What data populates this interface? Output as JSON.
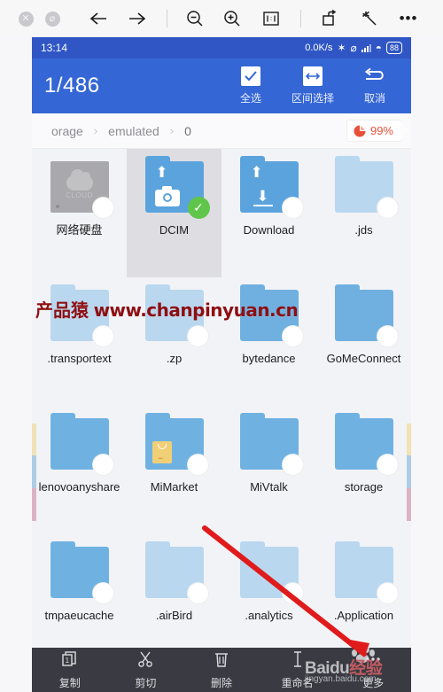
{
  "viewer": {
    "toolbar": [
      {
        "name": "close-button",
        "glyph": "✕",
        "type": "circle"
      },
      {
        "name": "block-button",
        "glyph": "⊘",
        "type": "circle"
      },
      {
        "name": "back-button",
        "glyph": "←",
        "type": "glyph"
      },
      {
        "name": "forward-button",
        "glyph": "→",
        "type": "glyph"
      },
      {
        "name": "separator",
        "glyph": "",
        "type": "sep"
      },
      {
        "name": "zoom-out-icon",
        "glyph": "",
        "type": "zoomout"
      },
      {
        "name": "zoom-in-icon",
        "glyph": "",
        "type": "zoomin"
      },
      {
        "name": "actual-size-icon",
        "glyph": "1:1",
        "type": "box"
      },
      {
        "name": "separator",
        "glyph": "",
        "type": "sep"
      },
      {
        "name": "rotate-icon",
        "glyph": "",
        "type": "rotate"
      },
      {
        "name": "magic-wand-icon",
        "glyph": "",
        "type": "wand"
      },
      {
        "name": "more-options-icon",
        "glyph": "•••",
        "type": "glyph"
      }
    ]
  },
  "status_bar": {
    "time": "13:14",
    "network_speed": "0.0K/s",
    "bluetooth_icon": "✶",
    "mute_icon": "⌀",
    "signal_icon": "signal-bars",
    "wifi_icon": "◠",
    "battery_level": "88"
  },
  "header": {
    "selection_count": "1/486",
    "actions": [
      {
        "label": "全选",
        "icon": "checkbox-checked",
        "name": "select-all"
      },
      {
        "label": "区间选择",
        "icon": "range-arrows",
        "name": "range-select"
      },
      {
        "label": "取消",
        "icon": "undo-arrow",
        "name": "cancel"
      }
    ]
  },
  "breadcrumb": {
    "items": [
      "orage",
      "emulated",
      "0"
    ],
    "separator": "›",
    "storage_badge": {
      "percent": "99%",
      "icon": "pie-chart-icon",
      "color": "#e8503a"
    }
  },
  "files": [
    {
      "name": "网络硬盘",
      "icon": "cloud-drive",
      "selected": false,
      "color": "#a9a9ad",
      "badge": "radio"
    },
    {
      "name": "DCIM",
      "icon": "folder-camera",
      "selected": true,
      "color": "#5ba3dd",
      "badge": "check"
    },
    {
      "name": "Download",
      "icon": "folder-download",
      "selected": false,
      "color": "#5ba3dd",
      "badge": "radio"
    },
    {
      "name": ".jds",
      "icon": "folder-plain",
      "selected": false,
      "color": "#b9d7ef",
      "badge": "radio"
    },
    {
      "name": ".transportext",
      "icon": "folder-plain",
      "selected": false,
      "color": "#b9d7ef",
      "badge": "radio"
    },
    {
      "name": ".zp",
      "icon": "folder-plain",
      "selected": false,
      "color": "#b9d7ef",
      "badge": "radio"
    },
    {
      "name": "bytedance",
      "icon": "folder-plain",
      "selected": false,
      "color": "#6fb0e0",
      "badge": "radio"
    },
    {
      "name": "GoMeConnect",
      "icon": "folder-plain",
      "selected": false,
      "color": "#6fb0e0",
      "badge": "radio"
    },
    {
      "name": "lenovoanyshare",
      "icon": "folder-plain",
      "selected": false,
      "color": "#6fb2e2",
      "badge": "radio"
    },
    {
      "name": "MiMarket",
      "icon": "folder-bag",
      "selected": false,
      "color": "#6fb2e2",
      "badge": "radio"
    },
    {
      "name": "MiVtalk",
      "icon": "folder-plain",
      "selected": false,
      "color": "#6fb2e2",
      "badge": "radio"
    },
    {
      "name": "storage",
      "icon": "folder-plain",
      "selected": false,
      "color": "#6fb2e2",
      "badge": "radio"
    },
    {
      "name": "tmpaeucache",
      "icon": "folder-plain",
      "selected": false,
      "color": "#6fb2e2",
      "badge": "radio"
    },
    {
      "name": ".airBird",
      "icon": "folder-plain",
      "selected": false,
      "color": "#b9d7ef",
      "badge": "radio"
    },
    {
      "name": ".analytics",
      "icon": "folder-plain",
      "selected": false,
      "color": "#b9d7ef",
      "badge": "radio"
    },
    {
      "name": ".Application",
      "icon": "folder-plain",
      "selected": false,
      "color": "#b9d7ef",
      "badge": "radio"
    }
  ],
  "bottom_bar": [
    {
      "label": "复制",
      "icon": "copy-icon",
      "name": "copy"
    },
    {
      "label": "剪切",
      "icon": "scissors-icon",
      "name": "cut"
    },
    {
      "label": "删除",
      "icon": "trash-icon",
      "name": "delete"
    },
    {
      "label": "重命名",
      "icon": "text-cursor-icon",
      "name": "rename"
    },
    {
      "label": "更多",
      "icon": "more-icon",
      "name": "more"
    }
  ],
  "watermarks": {
    "site_cn": "产品猿",
    "site_url": "www.chanpinyuan.cn",
    "baidu_main": "Bai",
    "baidu_du": "du",
    "baidu_cn": "经验",
    "baidu_url": "jingyan.baidu.com"
  }
}
